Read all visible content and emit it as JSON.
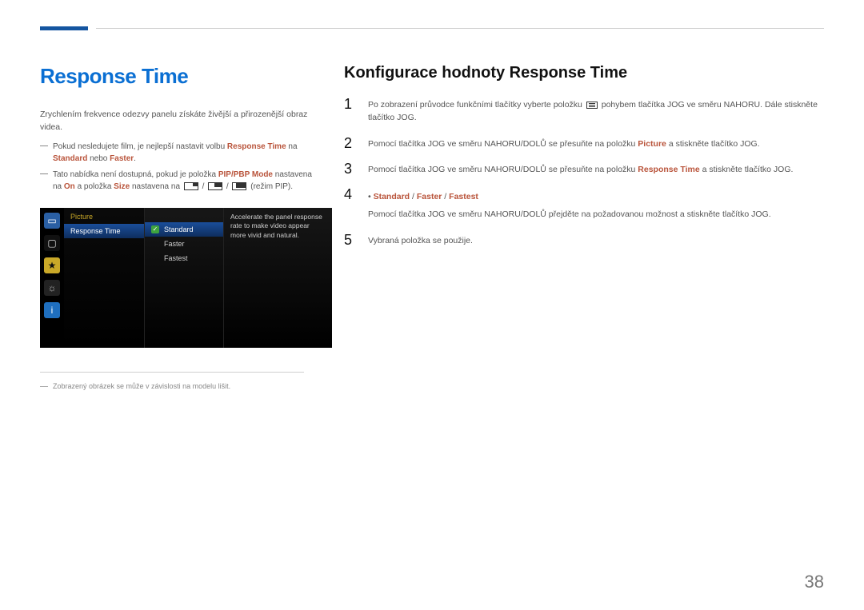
{
  "titles": {
    "left": "Response Time",
    "right": "Konfigurace hodnoty Response Time"
  },
  "left_intro": "Zrychlením frekvence odezvy panelu získáte živější a přirozenější obraz videa.",
  "note1": {
    "pre": "Pokud nesledujete film, je nejlepší nastavit volbu ",
    "hl1": "Response Time",
    "mid": " na ",
    "hl2": "Standard",
    "post": " nebo ",
    "hl3": "Faster",
    "end": "."
  },
  "note2": {
    "pre": "Tato nabídka není dostupná, pokud je položka ",
    "hl1": "PIP/PBP Mode",
    "mid": " nastavena na ",
    "hl2": "On",
    "line2pre": " a položka ",
    "hl3": "Size",
    "line2mid": " nastavena na ",
    "aftericons": " (režim PIP)."
  },
  "osd": {
    "menu_title": "Picture",
    "menu_item": "Response Time",
    "options": [
      "Standard",
      "Faster",
      "Fastest"
    ],
    "selected_index": 0,
    "description": "Accelerate the panel response rate to make video appear more vivid and natural."
  },
  "footnote": "Zobrazený obrázek se může v závislosti na modelu lišit.",
  "steps": {
    "s1a": "Po zobrazení průvodce funkčními tlačítky vyberte položku ",
    "s1b": " pohybem tlačítka JOG ve směru NAHORU. Dále stiskněte tlačítko JOG.",
    "s2a": "Pomocí tlačítka JOG ve směru NAHORU/DOLŮ se přesuňte na položku ",
    "s2hl": "Picture",
    "s2b": " a stiskněte tlačítko JOG.",
    "s3a": "Pomocí tlačítka JOG ve směru NAHORU/DOLŮ se přesuňte na položku ",
    "s3hl": "Response Time",
    "s3b": " a stiskněte tlačítko JOG.",
    "s4bullet_a": "Standard",
    "s4bullet_b": "Faster",
    "s4bullet_c": "Fastest",
    "s4": "Pomocí tlačítka JOG ve směru NAHORU/DOLŮ přejděte na požadovanou možnost a stiskněte tlačítko JOG.",
    "s5": "Vybraná položka se použije."
  },
  "page_number": "38"
}
